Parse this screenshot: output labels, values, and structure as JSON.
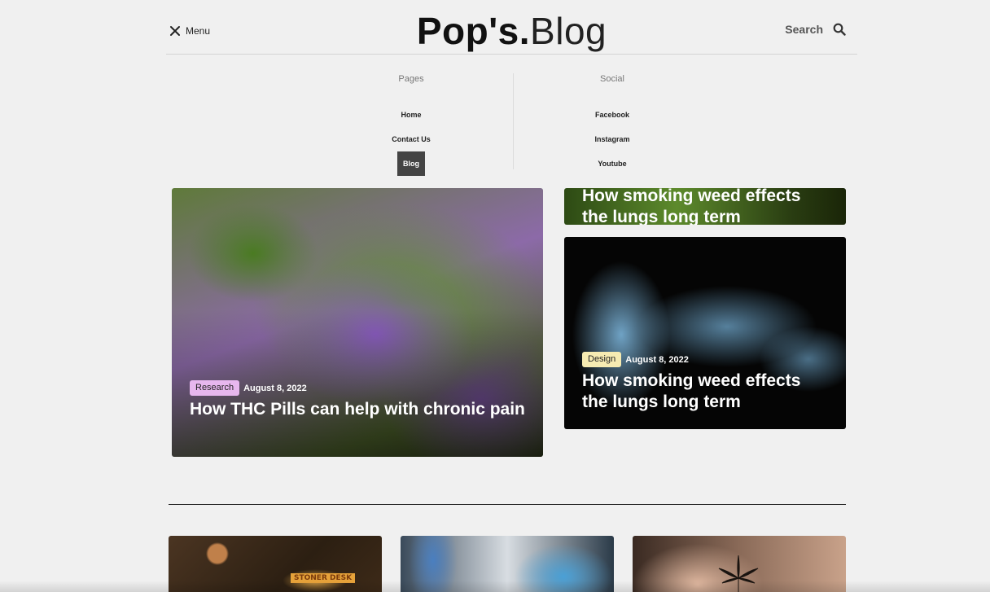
{
  "header": {
    "menu_label": "Menu",
    "logo_bold": "Pop's.",
    "logo_light": "Blog",
    "search_label": "Search"
  },
  "dropdown": {
    "pages": {
      "title": "Pages",
      "links": [
        "Home",
        "Contact Us",
        "Blog"
      ],
      "active": "Blog"
    },
    "social": {
      "title": "Social",
      "links": [
        "Facebook",
        "Instagram",
        "Youtube"
      ]
    }
  },
  "featured": {
    "main": {
      "tag": "Research",
      "date": "August 8, 2022",
      "title": "How THC Pills can help with chronic pain"
    },
    "top": {
      "title": "How smoking weed effects the lungs long term"
    },
    "smoke": {
      "tag": "Design",
      "date": "August 8, 2022",
      "title": "How smoking weed effects the lungs long term"
    }
  },
  "thumbs": {
    "desk_label": "STONER DESK"
  },
  "colors": {
    "background": "#f0f0f0",
    "tag_research": "#e7b7ee",
    "tag_design": "#f6ebb2",
    "active_link_bg": "#444444"
  }
}
